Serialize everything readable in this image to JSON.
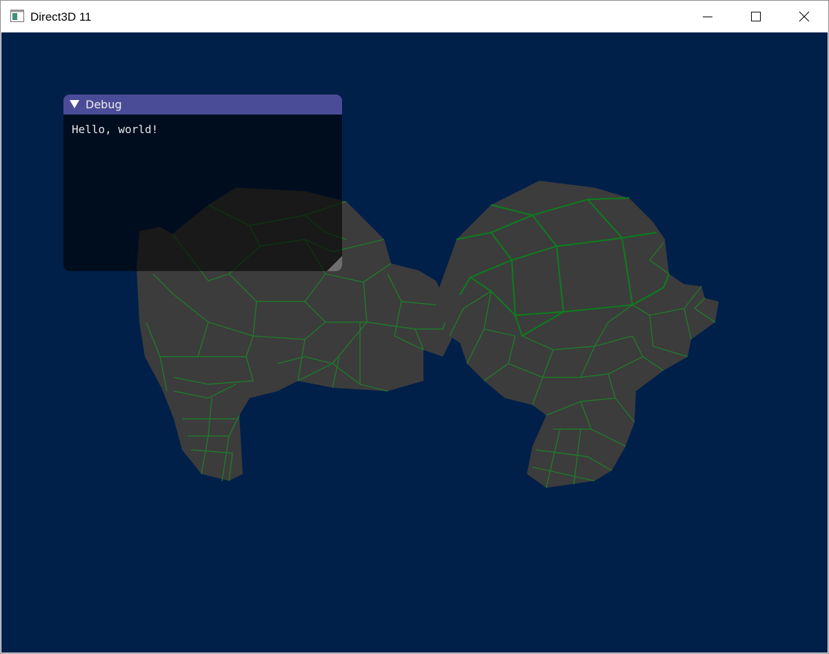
{
  "window": {
    "title": "Direct3D 11",
    "icon": "app-window-icon",
    "controls": {
      "minimize": "minimize-icon",
      "maximize": "maximize-icon",
      "close": "close-icon"
    }
  },
  "viewport": {
    "background_color": "#00204a",
    "mesh_fill_color": "#3c3c3c",
    "mesh_wire_color": "#1f7a2a"
  },
  "debug_panel": {
    "title": "Debug",
    "text": "Hello, world!",
    "title_bar_color": "#4a4c98",
    "collapse_icon": "triangle-down-icon",
    "resize_icon": "resize-grip-icon"
  }
}
